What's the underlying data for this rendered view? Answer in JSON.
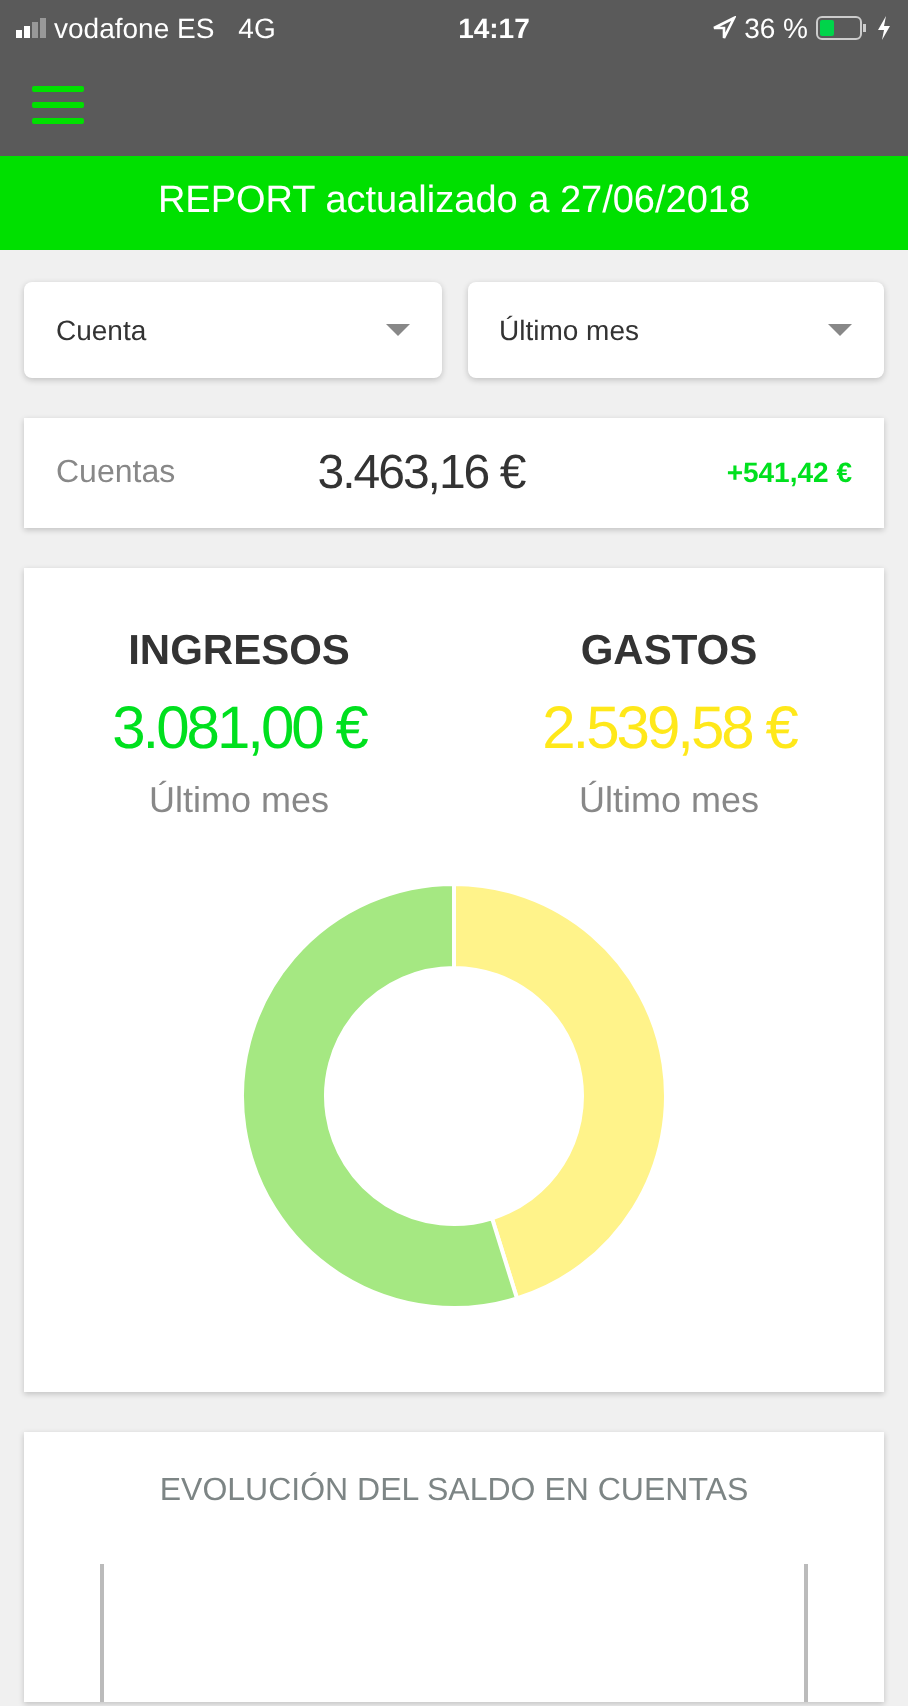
{
  "status_bar": {
    "carrier": "vodafone ES",
    "network": "4G",
    "time": "14:17",
    "battery_text": "36 %"
  },
  "banner": {
    "text": "REPORT actualizado a 27/06/2018"
  },
  "filters": [
    {
      "value": "Cuenta"
    },
    {
      "value": "Último mes"
    }
  ],
  "accounts": {
    "label": "Cuentas",
    "total": "3.463,16 €",
    "change": "+541,42 €"
  },
  "summary": {
    "columns": [
      {
        "title": "INGRESOS",
        "amount": "3.081,00 €",
        "period": "Último mes",
        "color": "#00e01e"
      },
      {
        "title": "GASTOS",
        "amount": "2.539,58 €",
        "period": "Último mes",
        "color": "#ffe81a"
      }
    ],
    "chart_data": {
      "type": "donut",
      "values": [
        45.2,
        54.8
      ],
      "colors": [
        "#fff38a",
        "#a5e882"
      ]
    }
  },
  "evolution": {
    "title": "EVOLUCIÓN DEL SALDO EN CUENTAS"
  }
}
